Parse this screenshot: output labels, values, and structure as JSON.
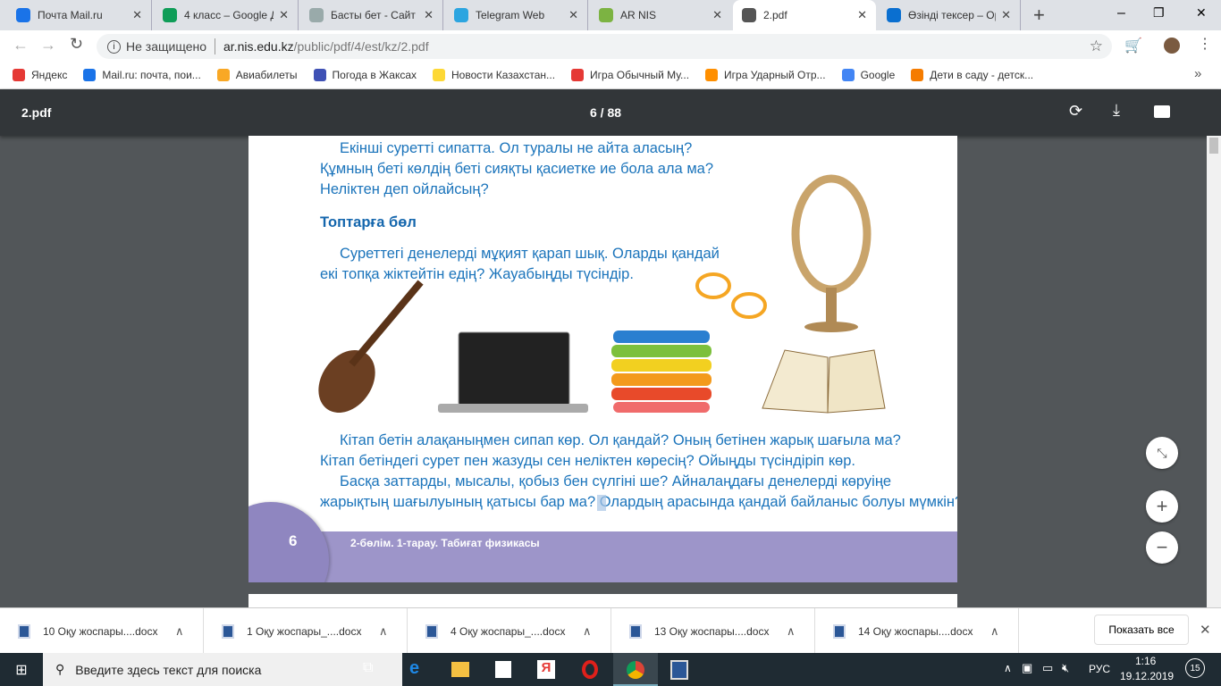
{
  "tabs": [
    {
      "label": "Почта Mail.ru",
      "color": "#1a73e8"
    },
    {
      "label": "4 класс – Google Д",
      "color": "#0f9d58"
    },
    {
      "label": "Басты бет - Сайт Н",
      "color": "#9aa"
    },
    {
      "label": "Telegram Web",
      "color": "#2ca5e0"
    },
    {
      "label": "AR NIS",
      "color": "#7cb342"
    },
    {
      "label": "2.pdf",
      "color": "#555"
    },
    {
      "label": "Өзінді тексер – Ор",
      "color": "#0a6fd0"
    }
  ],
  "tab_close": "✕",
  "new_tab": "+",
  "window": {
    "minimize": "–",
    "maximize": "❐",
    "close": "✕"
  },
  "address": {
    "security": "Не защищено",
    "domain": "ar.nis.edu.kz",
    "path": "/public/pdf/4/est/kz/2.pdf"
  },
  "bookmarks": [
    {
      "label": "Яндекс",
      "color": "#e53935"
    },
    {
      "label": "Mail.ru: почта, пои...",
      "color": "#1a73e8"
    },
    {
      "label": "Авиабилеты",
      "color": "#f9a825"
    },
    {
      "label": "Погода в Жаксах",
      "color": "#3f51b5"
    },
    {
      "label": "Новости Казахстан...",
      "color": "#fdd835"
    },
    {
      "label": "Игра Обычный Му...",
      "color": "#e53935"
    },
    {
      "label": "Игра Ударный Отр...",
      "color": "#ff8f00"
    },
    {
      "label": "Google",
      "color": "#4285f4"
    },
    {
      "label": "Дети в саду - детск...",
      "color": "#f57c00"
    }
  ],
  "bookmarks_more": "»",
  "pdf": {
    "title": "2.pdf",
    "page_indicator": "6 / 88",
    "page_current": 6,
    "page_total": 88
  },
  "content": {
    "p1": [
      "Екінші суретті сипатта. Ол туралы не айта аласың?",
      "Құмның беті көлдің беті сияқты қасиетке ие бола ала ма?",
      "Неліктен деп ойлайсың?"
    ],
    "heading": "Топтарға бөл",
    "p2": [
      "Суреттегі денелерді мұқият қарап шық. Оларды қандай",
      "екі топқа жіктейтін едің? Жауабыңды түсіндір."
    ],
    "p3": [
      "Кітап бетін алақаныңмен сипап көр. Ол қандай? Оның бетінен жарық шағыла ма?",
      "Кітап бетіндегі сурет пен жазуды сен неліктен көресің? Ойыңды түсіндіріп көр.",
      "Басқа заттарды, мысалы, қобыз бен сүлгіні ше? Айналаңдағы денелерді көруіңе",
      "жарықтың шағылуының қатысы бар ма? Олардың арасында қандай байланыс болуы мүмкін?"
    ],
    "page_number": "6",
    "footer": "2-бөлім. 1-тарау. Табиғат физикасы"
  },
  "downloads": [
    "10 Оқу жоспары....docx",
    "1 Оқу жоспары_....docx",
    "4 Оқу жоспары_....docx",
    "13 Оқу жоспары....docx",
    "14 Оқу жоспары....docx"
  ],
  "show_all": "Показать все",
  "taskbar": {
    "search_placeholder": "Введите здесь текст для поиска",
    "lang": "РУС",
    "time": "1:16",
    "date": "19.12.2019",
    "notifications": "15"
  }
}
